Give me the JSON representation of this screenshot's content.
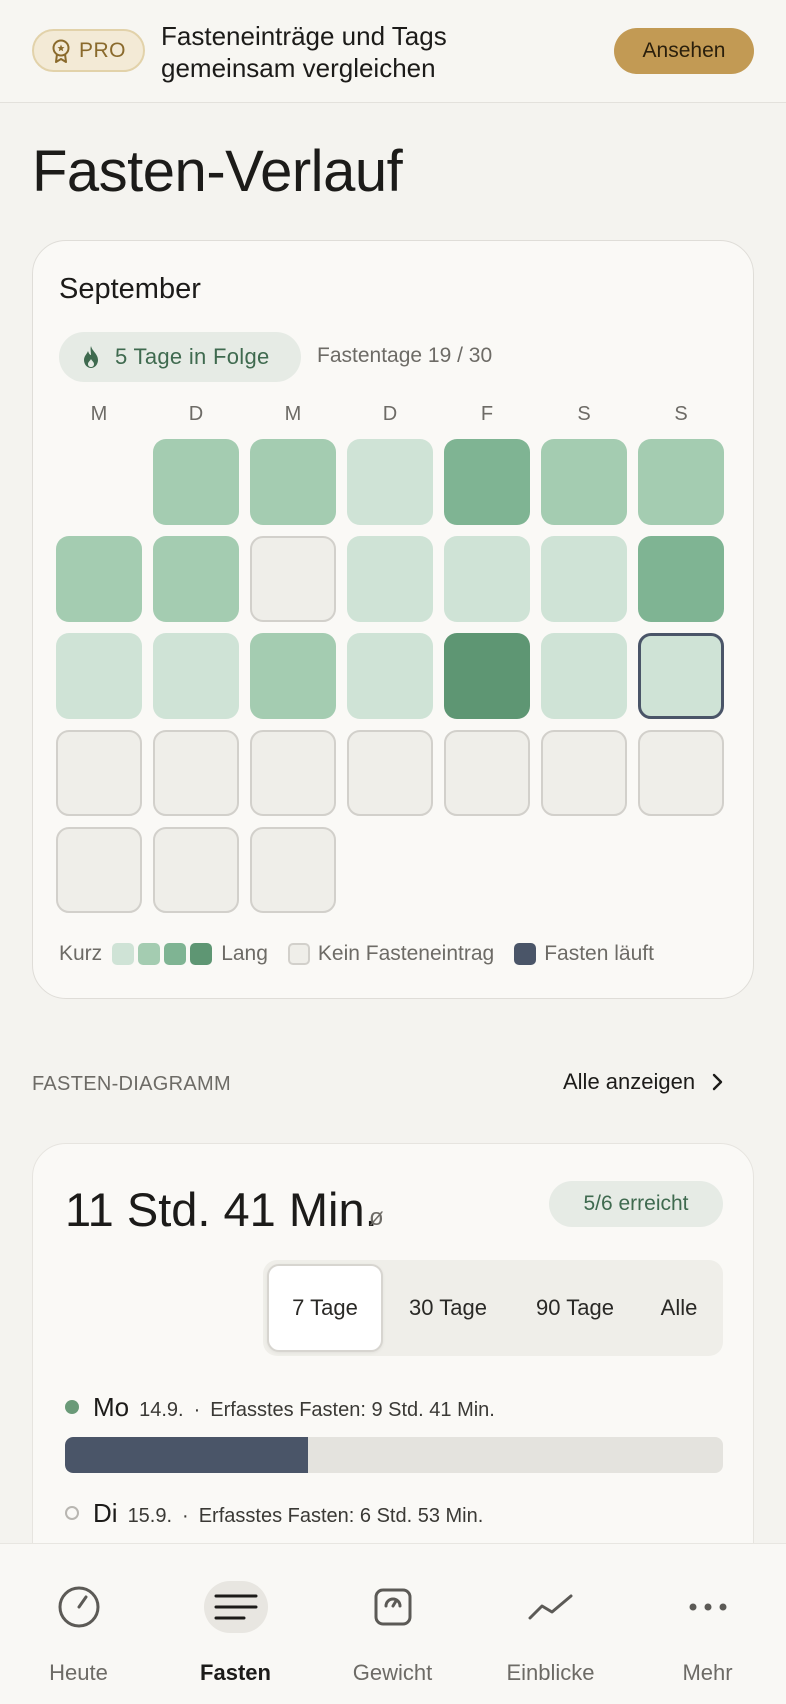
{
  "pro_banner": {
    "badge_label": "PRO",
    "line1": "Fasteneinträge und Tags",
    "line2": "gemeinsam vergleichen",
    "button_label": "Ansehen"
  },
  "page_title": "Fasten-Verlauf",
  "calendar": {
    "month": "September",
    "streak_label": "5 Tage in Folge",
    "fast_days_label": "Fastentage 19 / 30",
    "weekdays": [
      "M",
      "D",
      "M",
      "D",
      "F",
      "S",
      "S"
    ],
    "first_weekday_offset": 1,
    "days": [
      {
        "day": 1,
        "level": 2
      },
      {
        "day": 2,
        "level": 2
      },
      {
        "day": 3,
        "level": 1
      },
      {
        "day": 4,
        "level": 3
      },
      {
        "day": 5,
        "level": 2
      },
      {
        "day": 6,
        "level": 2
      },
      {
        "day": 7,
        "level": 2
      },
      {
        "day": 8,
        "level": 2
      },
      {
        "day": 9,
        "level": 0
      },
      {
        "day": 10,
        "level": 1
      },
      {
        "day": 11,
        "level": 1
      },
      {
        "day": 12,
        "level": 1
      },
      {
        "day": 13,
        "level": 3
      },
      {
        "day": 14,
        "level": 1
      },
      {
        "day": 15,
        "level": 1
      },
      {
        "day": 16,
        "level": 2
      },
      {
        "day": 17,
        "level": 1
      },
      {
        "day": 18,
        "level": 4
      },
      {
        "day": 19,
        "level": 1
      },
      {
        "day": 20,
        "level": "running"
      },
      {
        "day": 21,
        "level": 0
      },
      {
        "day": 22,
        "level": 0
      },
      {
        "day": 23,
        "level": 0
      },
      {
        "day": 24,
        "level": 0
      },
      {
        "day": 25,
        "level": 0
      },
      {
        "day": 26,
        "level": 0
      },
      {
        "day": 27,
        "level": 0
      },
      {
        "day": 28,
        "level": 0
      },
      {
        "day": 29,
        "level": 0
      },
      {
        "day": 30,
        "level": 0
      }
    ],
    "legend": {
      "short_label": "Kurz",
      "long_label": "Lang",
      "no_entry_label": "Kein Fasteneintrag",
      "running_label": "Fasten läuft"
    },
    "colors": {
      "level_1": "#cfe3d6",
      "level_2": "#a4ccb1",
      "level_3": "#7fb493",
      "level_4": "#5e9673",
      "running_border": "#4a5568"
    }
  },
  "diagram_section": {
    "title": "FASTEN-DIAGRAMM",
    "show_all_label": "Alle anzeigen"
  },
  "diagram": {
    "average_value": "11 Std. 41 Min.",
    "average_symbol": "ø",
    "achieved_label": "5/6 erreicht",
    "ranges": [
      "7 Tage",
      "30 Tage",
      "90 Tage",
      "Alle"
    ],
    "selected_range": "7 Tage",
    "entries": [
      {
        "day": "Mo",
        "date": "14.9.",
        "separator": "·",
        "desc": "Erfasstes Fasten: 9 Std. 41 Min.",
        "goal_reached": true,
        "progress": 0.37
      },
      {
        "day": "Di",
        "date": "15.9.",
        "separator": "·",
        "desc": "Erfasstes Fasten: 6 Std. 53 Min.",
        "goal_reached": false,
        "progress": 0.26
      }
    ]
  },
  "bottom_nav": [
    {
      "label": "Heute",
      "icon": "clock-icon",
      "active": false
    },
    {
      "label": "Fasten",
      "icon": "list-icon",
      "active": true
    },
    {
      "label": "Gewicht",
      "icon": "scale-icon",
      "active": false
    },
    {
      "label": "Einblicke",
      "icon": "trend-icon",
      "active": false
    },
    {
      "label": "Mehr",
      "icon": "more-icon",
      "active": false
    }
  ]
}
